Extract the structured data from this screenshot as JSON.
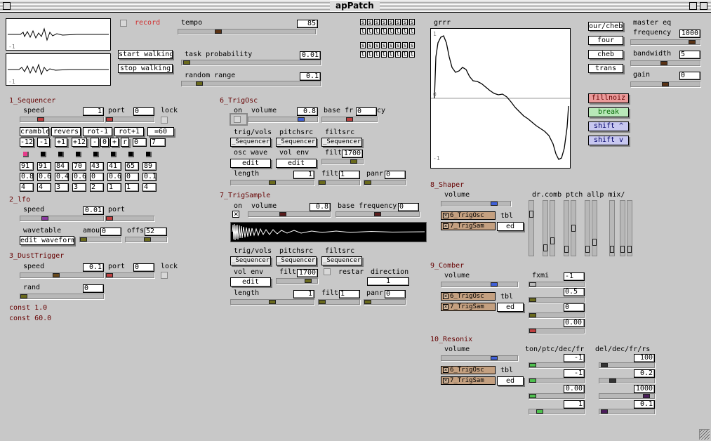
{
  "window": {
    "title": "apPatch"
  },
  "colors": {
    "accent_red": "#a01010",
    "fill": "#ea9a9a",
    "break": "#b8e8b8",
    "shift": "#c8c8f0",
    "knob_red": "#c04040",
    "knob_blue": "#4060d8",
    "knob_olive": "#6a6a1c",
    "knob_brown": "#5a3214",
    "knob_purple": "#8a3aa0"
  },
  "top": {
    "record": "record",
    "tempo_label": "tempo",
    "tempo": "85",
    "start_walking": "start walking",
    "stop_walking": "stop walking",
    "task_prob_label": "task probability",
    "task_prob": "0.01",
    "random_range_label": "random range",
    "random_range": "0.1",
    "scope_tick": "-1",
    "step_top": [
      "s",
      "s",
      "s",
      "s",
      "s",
      "s",
      "s",
      "s"
    ],
    "step_bot": [
      "l",
      "l",
      "l",
      "l",
      "l",
      "l",
      "l",
      "l"
    ]
  },
  "seq": {
    "title": "1_Sequencer",
    "speed_label": "speed",
    "speed": "1",
    "port_label": "port",
    "port": "0",
    "lock_label": "lock",
    "buttons": [
      "cramble",
      "revers",
      "rot-1",
      "rot+1",
      "=60"
    ],
    "buttons2": [
      "-12",
      "-1",
      "+1",
      "+12",
      "-",
      "0",
      "+",
      "r",
      "0"
    ],
    "steps": "7",
    "row1": [
      "91",
      "91",
      "84",
      "70",
      "43",
      "41",
      "65",
      "89"
    ],
    "row2": [
      "0.8",
      "0.6",
      "0.4",
      "0.6",
      "0",
      "0.6",
      "0",
      "0.1"
    ],
    "row3": [
      "4",
      "4",
      "3",
      "3",
      "2",
      "1",
      "1",
      "4"
    ]
  },
  "lfo": {
    "title": "2_lfo",
    "speed_label": "speed",
    "speed": "0.01",
    "port_label": "port",
    "wavetable_label": "wavetable",
    "edit_waveform": "edit waveform",
    "amount_label": "amou",
    "amount": "0",
    "offset_label": "offs",
    "offset": "52"
  },
  "dust": {
    "title": "3_DustTrigger",
    "speed_label": "speed",
    "speed": "0.1",
    "port_label": "port",
    "port": "0",
    "lock_label": "lock",
    "rand_label": "rand",
    "rand": "0",
    "const1": "const 1.0",
    "const2": "const 60.0"
  },
  "trigosc": {
    "title": "6_TrigOsc",
    "on_label": "on",
    "volume_label": "volume",
    "volume": "0.8",
    "basefreq_label": "base fr",
    "basefreq": "0",
    "basefreq_tail": "cy",
    "trig_label": "trig/vols",
    "pitch_label": "pitchsrc",
    "filt_label": "filtsrc",
    "trig_src": "_Sequencer",
    "pitch_src": "_Sequencer",
    "filt_src": "_Sequencer",
    "osc_wave_label": "osc wave",
    "vol_env_label": "vol env",
    "filter_label": "filter",
    "filter": "1700",
    "edit1": "edit",
    "edit2": "edit",
    "length_label": "length",
    "length": "1",
    "filtenv_label": "filte",
    "filtenv": "1",
    "panrand_label": "panr",
    "panrand": "0"
  },
  "trigsample": {
    "title": "7_TrigSample",
    "on_label": "on",
    "volume_label": "volume",
    "volume": "0.8",
    "basefreq_label": "base frequency",
    "basefreq": "0",
    "trig_label": "trig/vols",
    "pitch_label": "pitchsrc",
    "filt_label": "filtsrc",
    "trig_src": "_Sequencer",
    "pitch_src": "_Sequencer",
    "filt_src": "_Sequencer",
    "vol_env_label": "vol env",
    "edit": "edit",
    "filt_label2": "filt",
    "filt": "1700",
    "restart_label": "restar",
    "direction_label": "direction",
    "direction": "1",
    "length_label": "length",
    "length": "1",
    "filtenv_label": "filte",
    "filtenv": "1",
    "panrand_label": "panr",
    "panrand": "0"
  },
  "grrr": {
    "title": "grrr",
    "top": "1",
    "mid": "0",
    "bottom": "-1"
  },
  "cheb": {
    "buttons": [
      "our/cheb",
      "four",
      "cheb",
      "trans"
    ],
    "fillnoiz": "fillnoiz",
    "break": "break",
    "shift_up": "shift ^",
    "shift_down": "shift v"
  },
  "master": {
    "title": "master eq",
    "frequency_label": "frequency",
    "frequency": "1000",
    "bandwidth_label": "bandwidth",
    "bandwidth": "5",
    "gain_label": "gain",
    "gain": "0"
  },
  "shaper": {
    "title": "8_Shaper",
    "volume_label": "volume",
    "src1": "6_TrigOsc",
    "src2": "7_TrigSam",
    "tbl": "tbl",
    "ed": "ed",
    "col_labels": "dr.comb  ptch  allp   mix/"
  },
  "comber": {
    "title": "9_Comber",
    "volume_label": "volume",
    "src1": "6_TrigOsc",
    "src2": "7_TrigSam",
    "tbl": "tbl",
    "ed": "ed",
    "fxmi_label": "fxmi",
    "fxmi": "-1",
    "v2": "0.5",
    "v3": "0",
    "v4": "0.00"
  },
  "resonix": {
    "title": "10_Resonix",
    "volume_label": "volume",
    "src1": "6_TrigOsc",
    "src2": "7_TrigSam",
    "tbl": "tbl",
    "ed": "ed",
    "col1_label": "ton/ptc/dec/fr",
    "col2_label": "del/dec/fr/rs",
    "col1": [
      "-1",
      "-1",
      "0.00",
      "1"
    ],
    "col2": [
      "100",
      "0.2",
      "1000",
      "0.1"
    ]
  }
}
